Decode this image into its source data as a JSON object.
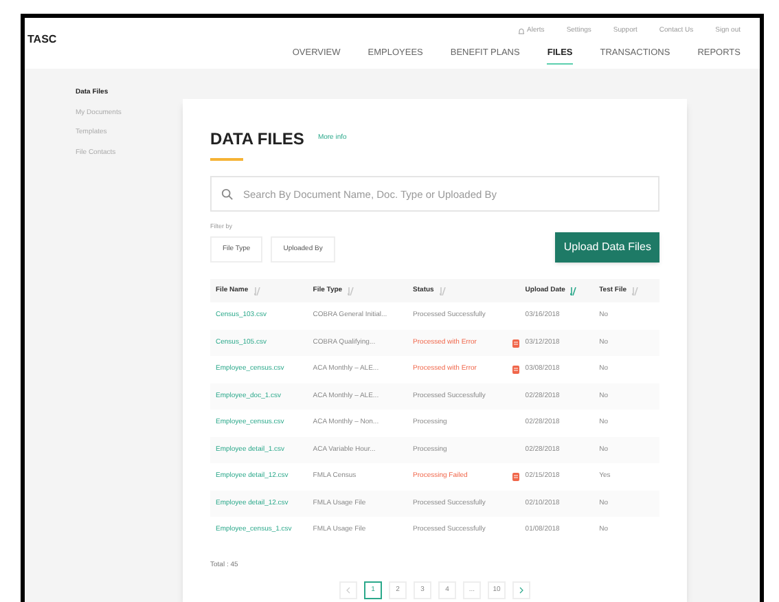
{
  "logo": "TASC",
  "utility_links": [
    {
      "label": "Alerts",
      "icon": true
    },
    {
      "label": "Settings",
      "icon": false
    },
    {
      "label": "Support",
      "icon": false
    },
    {
      "label": "Contact Us",
      "icon": false
    },
    {
      "label": "Sign out",
      "icon": false
    }
  ],
  "nav": [
    {
      "label": "OVERVIEW",
      "selected": false
    },
    {
      "label": "EMPLOYEES",
      "selected": false
    },
    {
      "label": "BENEFIT PLANS",
      "selected": false
    },
    {
      "label": "FILES",
      "selected": true
    },
    {
      "label": "TRANSACTIONS",
      "selected": false
    },
    {
      "label": "REPORTS",
      "selected": false
    }
  ],
  "sidebar": {
    "items": [
      {
        "label": "Data Files",
        "selected": true
      },
      {
        "label": "My Documents",
        "selected": false
      },
      {
        "label": "Templates",
        "selected": false
      },
      {
        "label": "File Contacts",
        "selected": false
      }
    ]
  },
  "title": "DATA FILES",
  "more_info": "More info",
  "search": {
    "placeholder": "Search By Document Name, Doc. Type or Uploaded By"
  },
  "filter_label": "Filter by",
  "filters": [
    "File Type",
    "Uploaded By"
  ],
  "upload_button": "Upload Data Files",
  "table": {
    "columns": [
      {
        "label": "File Name",
        "sorted": false
      },
      {
        "label": "File Type",
        "sorted": false
      },
      {
        "label": "Status",
        "sorted": false
      },
      {
        "label": "Upload Date",
        "sorted": true
      },
      {
        "label": "Test File",
        "sorted": false
      }
    ],
    "rows": [
      {
        "name": "Census_103.csv",
        "type": "COBRA General Initial...",
        "status": "Processed Successfully",
        "kind": "ok",
        "date": "03/16/2018",
        "test": "No"
      },
      {
        "name": "Census_105.csv",
        "type": "COBRA Qualifying...",
        "status": "Processed with Error",
        "kind": "error",
        "date": "03/12/2018",
        "test": "No"
      },
      {
        "name": "Employee_census.csv",
        "type": "ACA Monthly – ALE...",
        "status": "Processed with Error",
        "kind": "error",
        "date": "03/08/2018",
        "test": "No"
      },
      {
        "name": "Employee_doc_1.csv",
        "type": "ACA Monthly – ALE...",
        "status": "Processed Successfully",
        "kind": "ok",
        "date": "02/28/2018",
        "test": "No"
      },
      {
        "name": "Employee_census.csv",
        "type": "ACA Monthly – Non...",
        "status": "Processing",
        "kind": "ok",
        "date": "02/28/2018",
        "test": "No"
      },
      {
        "name": "Employee detail_1.csv",
        "type": "ACA Variable Hour...",
        "status": "Processing",
        "kind": "ok",
        "date": "02/28/2018",
        "test": "No"
      },
      {
        "name": "Employee detail_12.csv",
        "type": "FMLA Census",
        "status": "Processing Failed",
        "kind": "error",
        "date": "02/15/2018",
        "test": "Yes"
      },
      {
        "name": "Employee detail_12.csv",
        "type": "FMLA Usage File",
        "status": "Processed Successfully",
        "kind": "ok",
        "date": "02/10/2018",
        "test": "No"
      },
      {
        "name": "Employee_census_1.csv",
        "type": "FMLA Usage File",
        "status": "Processed Successfully",
        "kind": "ok",
        "date": "01/08/2018",
        "test": "No"
      }
    ]
  },
  "total": "Total : 45",
  "pagination": [
    {
      "label": "1",
      "selected": true
    },
    {
      "label": "2",
      "selected": false
    },
    {
      "label": "3",
      "selected": false
    },
    {
      "label": "4",
      "selected": false
    },
    {
      "label": "...",
      "selected": false
    },
    {
      "label": "10",
      "selected": false
    }
  ]
}
